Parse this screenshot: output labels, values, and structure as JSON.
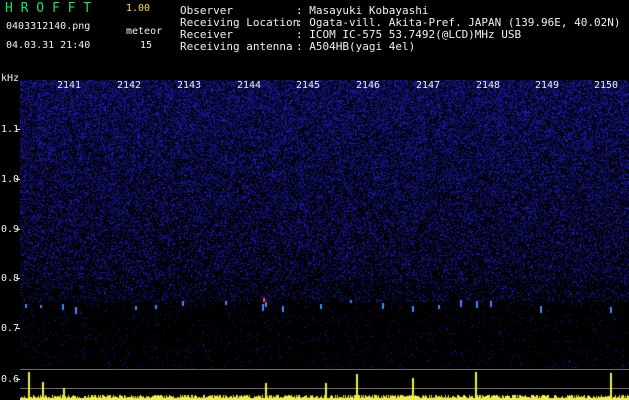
{
  "app": {
    "title": "H R O F F T",
    "version": "1.00"
  },
  "file": {
    "name": "0403312140.png",
    "datetime": "04.03.31 21:40"
  },
  "meteor": {
    "label": "meteor",
    "count": "15"
  },
  "info": [
    {
      "label": "Observer",
      "value": ": Masayuki Kobayashi"
    },
    {
      "label": "Receiving Location",
      "value": ": Ogata-vill. Akita-Pref. JAPAN (139.96E, 40.02N)"
    },
    {
      "label": "Receiver",
      "value": ": ICOM IC-575 53.7492(@LCD)MHz USB"
    },
    {
      "label": "Receiving antenna",
      "value": ": A504HB(yagi 4el)"
    }
  ],
  "axis": {
    "unit": "kHz",
    "y_labels": [
      "1.1",
      "1.0",
      "0.9",
      "0.8",
      "0.7",
      "0.6"
    ],
    "x_labels": [
      "2141",
      "2142",
      "2143",
      "2144",
      "2145",
      "2146",
      "2147",
      "2148",
      "2149",
      "2150"
    ]
  },
  "colors": {
    "background": "#000000",
    "noise": "#1a1aa0",
    "echo": "#3c8cff",
    "power": "#f0f04a",
    "title": "#16e06a",
    "version": "#f4e04a"
  }
}
